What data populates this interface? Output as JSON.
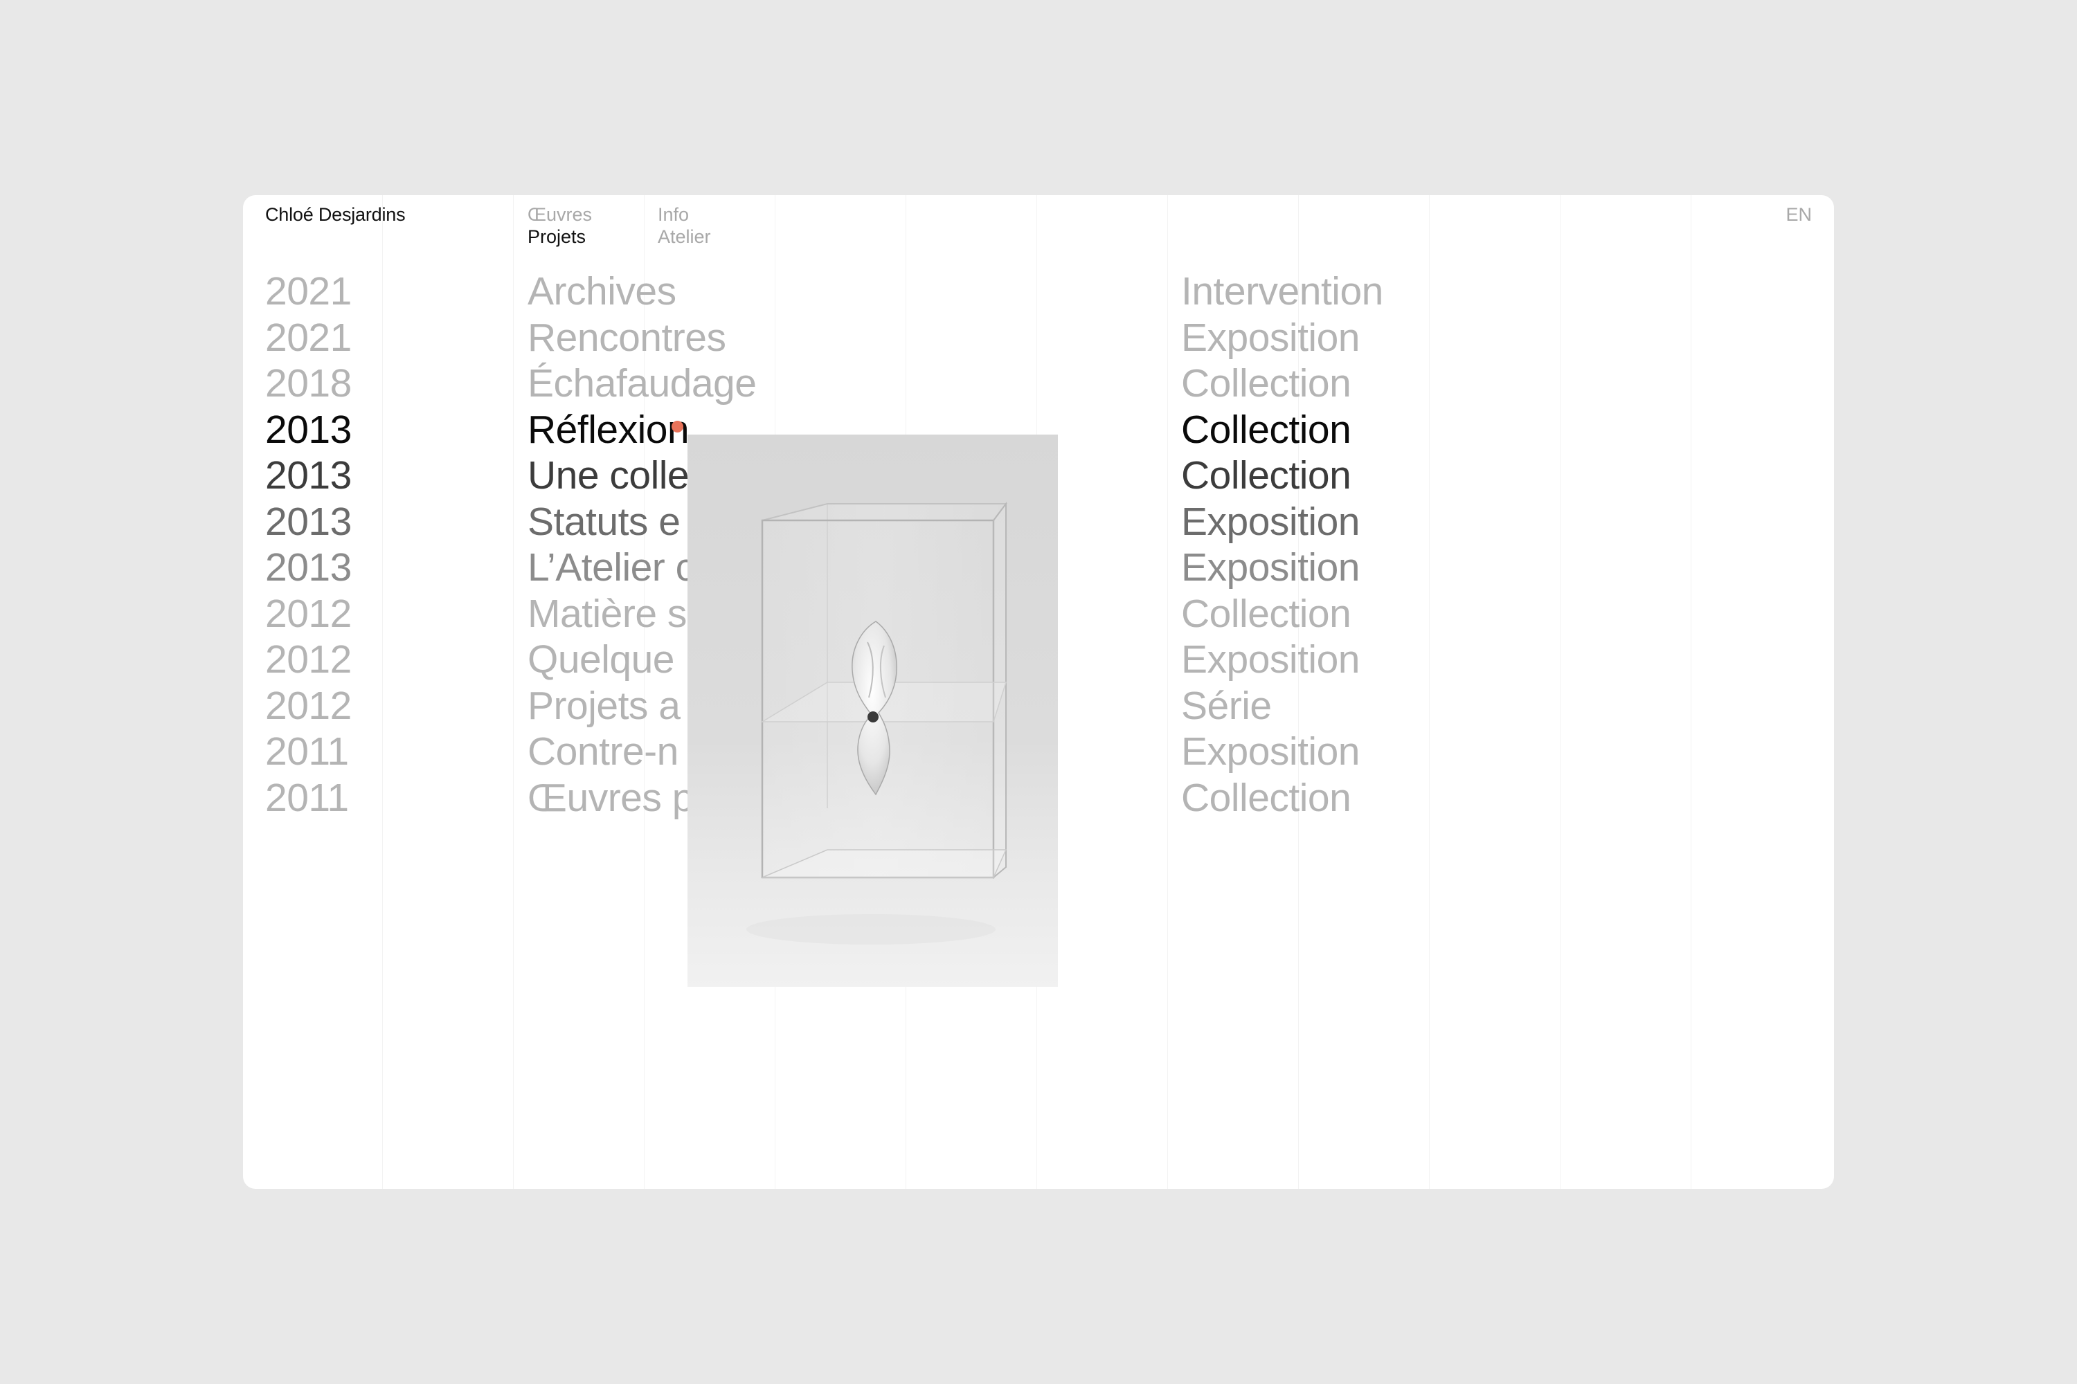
{
  "site": {
    "name": "Chloé Desjardins"
  },
  "nav": {
    "col1": [
      {
        "label": "Œuvres",
        "active": false
      },
      {
        "label": "Projets",
        "active": true
      }
    ],
    "col2": [
      {
        "label": "Info",
        "active": false
      },
      {
        "label": "Atelier",
        "active": false
      }
    ],
    "lang": "EN"
  },
  "projects": [
    {
      "year": "2021",
      "title": "Archives",
      "type": "Intervention",
      "color": "#b4b4b4"
    },
    {
      "year": "2021",
      "title": "Rencontres",
      "type": "Exposition",
      "color": "#b4b4b4"
    },
    {
      "year": "2018",
      "title": "Échafaudage",
      "type": "Collection",
      "color": "#b4b4b4"
    },
    {
      "year": "2013",
      "title": "Réflexion",
      "type": "Collection",
      "color": "#0a0a0a"
    },
    {
      "year": "2013",
      "title": "Une colle",
      "type": "Collection",
      "color": "#3c3c3c"
    },
    {
      "year": "2013",
      "title": "Statuts e",
      "type": "Exposition",
      "color": "#6c6c6c"
    },
    {
      "year": "2013",
      "title": "L’Atelier c",
      "type": "Exposition",
      "color": "#8c8c8c"
    },
    {
      "year": "2012",
      "title": "Matière s",
      "type": "Collection",
      "color": "#b4b4b4"
    },
    {
      "year": "2012",
      "title": "Quelque",
      "type": "Exposition",
      "color": "#b4b4b4"
    },
    {
      "year": "2012",
      "title": "Projets a",
      "type": "Série",
      "color": "#b4b4b4"
    },
    {
      "year": "2011",
      "title": "Contre-n",
      "type": "Exposition",
      "color": "#b4b4b4"
    },
    {
      "year": "2011",
      "title": "Œuvres p",
      "type": "Collection",
      "color": "#b4b4b4"
    }
  ],
  "colors": {
    "background": "#e8e8e8",
    "panel": "#ffffff",
    "muted_text": "#a8a8a8",
    "active_text": "#111111",
    "cursor_accent": "#e8735a"
  }
}
